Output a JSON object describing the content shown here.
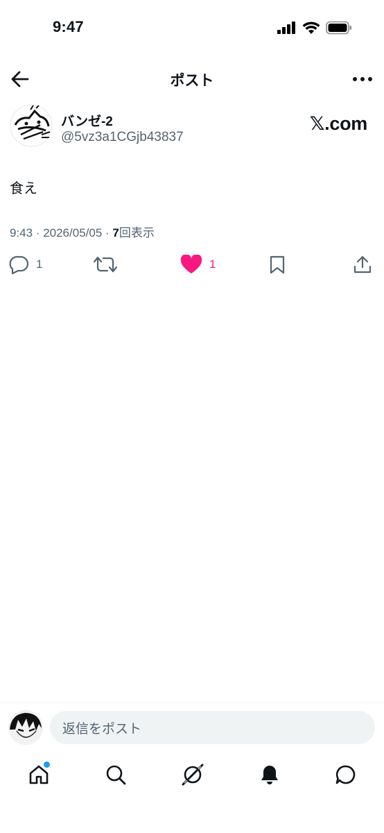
{
  "status_bar": {
    "time": "9:47"
  },
  "header": {
    "title": "ポスト"
  },
  "post": {
    "author_name": "バンゼ-2",
    "author_handle": "@5vz3a1CGjb43837",
    "brand": "𝕏.com",
    "text": "食え",
    "meta_time_date": "9:43 · 2026/05/05 · ",
    "views_count": "7",
    "views_label": "回表示",
    "actions": {
      "reply_count": "1",
      "like_count": "1",
      "liked": true
    }
  },
  "reply": {
    "placeholder": "返信をポスト"
  },
  "nav": {
    "items": [
      "home",
      "search",
      "grok",
      "notifications",
      "messages"
    ],
    "home_has_badge": true
  },
  "colors": {
    "like": "#f91880",
    "badge": "#1d9bf0",
    "secondary_text": "#536471"
  }
}
